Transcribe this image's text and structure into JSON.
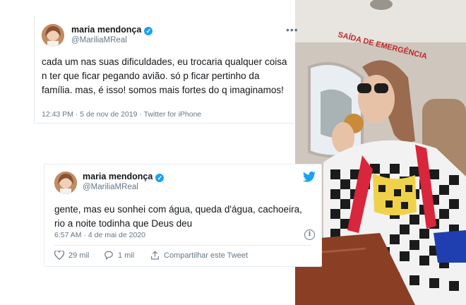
{
  "tweet_top": {
    "display_name": "maria mendonça",
    "handle": "@MariliaMReal",
    "text": "cada um nas suas dificuldades, eu trocaria qualquer coisa n ter que ficar pegando avião. só p ficar pertinho da família. mas, é isso! somos mais fortes do q imaginamos!",
    "timestamp": "12:43 PM · 5 de nov de 2019 · Twitter for iPhone",
    "more_icon": "more-horizontal-icon"
  },
  "tweet_bottom": {
    "display_name": "maria mendonça",
    "handle": "@MariliaMReal",
    "text": "gente, mas eu sonhei com água, queda d'água, cachoeira, rio a noite todinha que Deus deu",
    "timestamp": "6:57 AM · 4 de mai de 2020",
    "likes": "29 mil",
    "replies": "1 mil",
    "share_label": "Compartilhar este Tweet"
  },
  "photo": {
    "emergency_sign": "SAÍDA DE EMERGÊNCIA"
  },
  "colors": {
    "twitter_blue": "#1da1f2",
    "text_primary": "#14171a",
    "text_secondary": "#657786",
    "divider": "#e6ecf0"
  }
}
